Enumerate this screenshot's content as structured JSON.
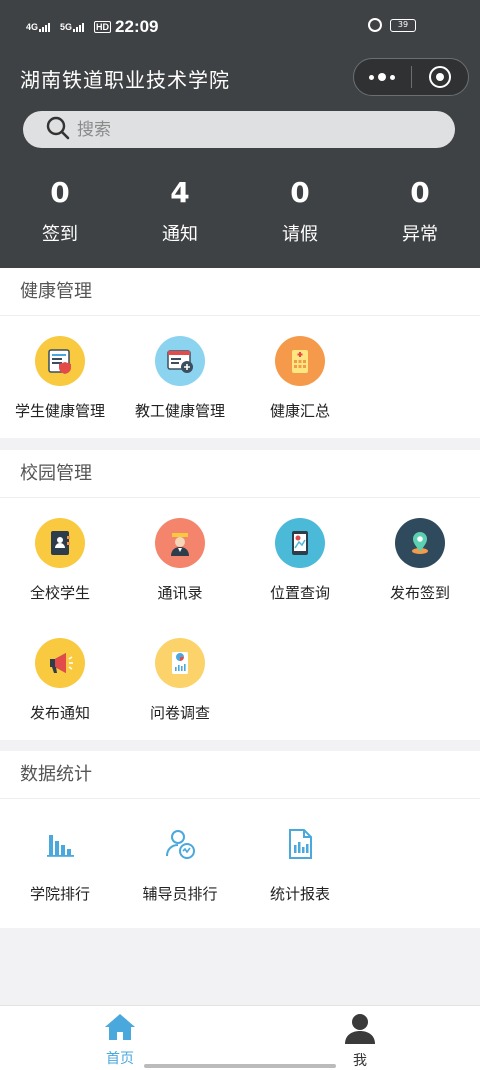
{
  "statusbar": {
    "signal1": "4G",
    "signal2": "5G",
    "hd_label": "HD",
    "time": "22:09",
    "battery": "39"
  },
  "header": {
    "title": "湖南铁道职业技术学院"
  },
  "search": {
    "placeholder": "搜索"
  },
  "stats": [
    {
      "value": "0",
      "label": "签到"
    },
    {
      "value": "4",
      "label": "通知"
    },
    {
      "value": "0",
      "label": "请假"
    },
    {
      "value": "0",
      "label": "异常"
    }
  ],
  "health": {
    "title": "健康管理",
    "items": [
      {
        "label": "学生健康管理",
        "icon": "student-health-icon"
      },
      {
        "label": "教工健康管理",
        "icon": "staff-health-icon"
      },
      {
        "label": "健康汇总",
        "icon": "health-summary-icon"
      }
    ]
  },
  "campus": {
    "title": "校园管理",
    "items": [
      {
        "label": "全校学生",
        "icon": "student-book-icon"
      },
      {
        "label": "通讯录",
        "icon": "contacts-icon"
      },
      {
        "label": "位置查询",
        "icon": "location-query-icon"
      },
      {
        "label": "发布签到",
        "icon": "publish-checkin-icon"
      },
      {
        "label": "发布通知",
        "icon": "megaphone-icon"
      },
      {
        "label": "问卷调查",
        "icon": "survey-icon"
      }
    ]
  },
  "stats_section": {
    "title": "数据统计",
    "items": [
      {
        "label": "学院排行",
        "icon": "bar-chart-icon"
      },
      {
        "label": "辅导员排行",
        "icon": "counselor-icon"
      },
      {
        "label": "统计报表",
        "icon": "report-icon"
      }
    ]
  },
  "tabbar": {
    "home": "首页",
    "me": "我"
  },
  "colors": {
    "header_bg": "#3f4244",
    "accent_blue": "#4aa8dc",
    "yellow": "#f9c940",
    "light_blue": "#8cd3ef",
    "orange": "#f59a4a",
    "salmon": "#f4846c",
    "teal": "#4bb9d8",
    "navy": "#2e4a5c"
  }
}
